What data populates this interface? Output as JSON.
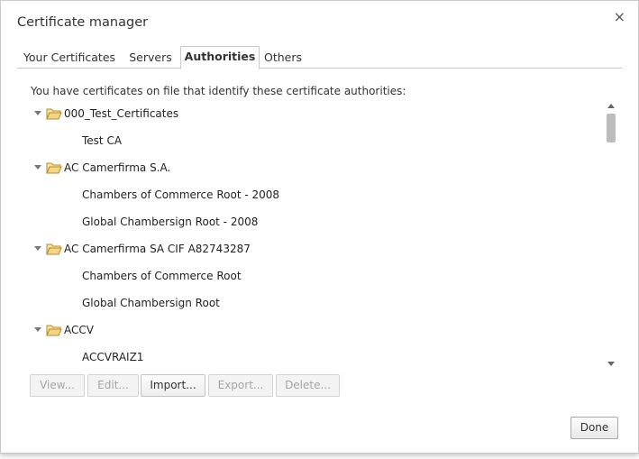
{
  "dialog": {
    "title": "Certificate manager",
    "close_icon": "×"
  },
  "tabs": [
    {
      "label": "Your Certificates",
      "active": false
    },
    {
      "label": "Servers",
      "active": false
    },
    {
      "label": "Authorities",
      "active": true
    },
    {
      "label": "Others",
      "active": false
    }
  ],
  "description": "You have certificates on file that identify these certificate authorities:",
  "tree": [
    {
      "group": "000_Test_Certificates",
      "expanded": true,
      "items": [
        "Test CA"
      ]
    },
    {
      "group": "AC Camerfirma S.A.",
      "expanded": true,
      "items": [
        "Chambers of Commerce Root - 2008",
        "Global Chambersign Root - 2008"
      ]
    },
    {
      "group": "AC Camerfirma SA CIF A82743287",
      "expanded": true,
      "items": [
        "Chambers of Commerce Root",
        "Global Chambersign Root"
      ]
    },
    {
      "group": "ACCV",
      "expanded": true,
      "items": [
        "ACCVRAIZ1"
      ]
    }
  ],
  "buttons": {
    "view": {
      "label": "View...",
      "enabled": false
    },
    "edit": {
      "label": "Edit...",
      "enabled": false
    },
    "import": {
      "label": "Import...",
      "enabled": true
    },
    "export": {
      "label": "Export...",
      "enabled": false
    },
    "delete": {
      "label": "Delete...",
      "enabled": false
    },
    "done": {
      "label": "Done",
      "enabled": true
    }
  },
  "colors": {
    "folder_fill": "#f3d68a",
    "folder_stroke": "#b88a2a"
  }
}
